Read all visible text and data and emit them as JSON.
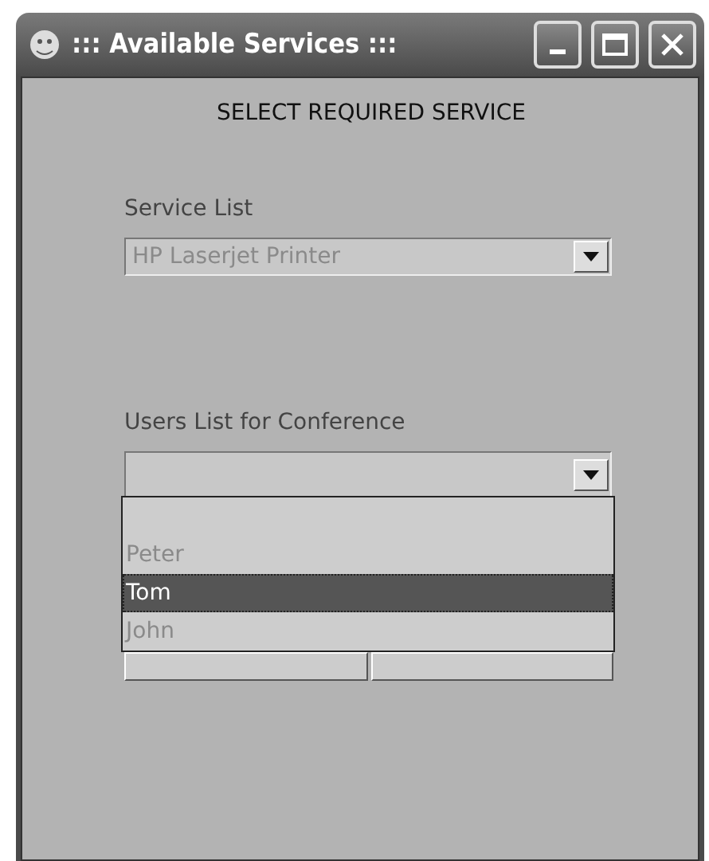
{
  "window": {
    "title": "::: Available Services :::"
  },
  "heading": "SELECT REQUIRED SERVICE",
  "service_list": {
    "label": "Service List",
    "value": "HP Laserjet Printer",
    "disabled": true
  },
  "users_list": {
    "label": "Users List for Conference",
    "expanded": true,
    "options": [
      {
        "selected": false
      },
      {
        "label": "Peter",
        "selected": false
      },
      {
        "label": "Tom",
        "selected": true
      },
      {
        "label": "John",
        "selected": false
      }
    ]
  }
}
